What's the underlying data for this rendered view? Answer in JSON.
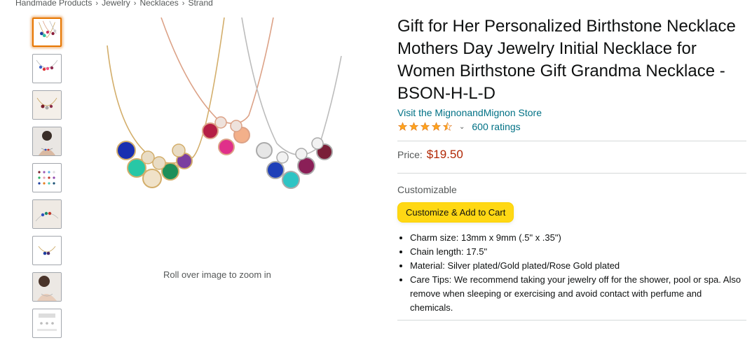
{
  "breadcrumb": [
    "Handmade Products",
    "Jewelry",
    "Necklaces",
    "Strand"
  ],
  "breadcrumb_separator": "›",
  "gallery": {
    "thumbnail_count": 9,
    "selected_index": 0,
    "zoom_hint": "Roll over image to zoom in"
  },
  "product": {
    "title": "Gift for Her Personalized Birthstone Necklace Mothers Day Jewelry Initial Necklace for Women Birthstone Gift Grandma Necklace - BSON-H-L-D",
    "store_link": "Visit the MignonandMignon Store",
    "rating_stars": 4.5,
    "ratings_count": "600 ratings",
    "price_label": "Price:",
    "price": "$19.50",
    "customizable_label": "Customizable",
    "customize_button": "Customize & Add to Cart",
    "bullets": [
      "Charm size: 13mm x 9mm (.5\" x .35\")",
      "Chain length: 17.5\"",
      "Material: Silver plated/Gold plated/Rose Gold plated",
      "Care Tips: We recommend taking your jewelry off for the shower, pool or spa. Also remove when sleeping or exercising and avoid contact with perfume and chemicals."
    ]
  },
  "colors": {
    "link": "#007185",
    "price": "#b12704",
    "button": "#ffd814",
    "star": "#ffa41c",
    "selected_thumb": "#e77600"
  }
}
